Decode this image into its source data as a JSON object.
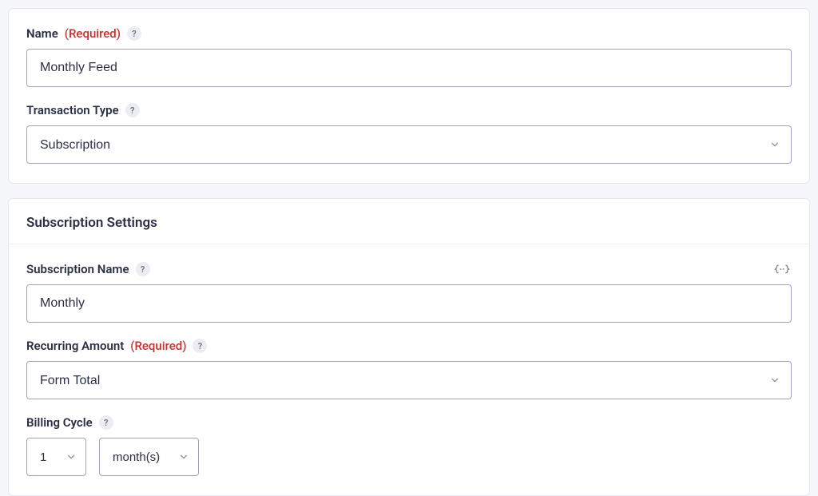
{
  "topPanel": {
    "name": {
      "label": "Name",
      "required": "(Required)",
      "helpGlyph": "?",
      "value": "Monthly Feed"
    },
    "transactionType": {
      "label": "Transaction Type",
      "helpGlyph": "?",
      "value": "Subscription"
    }
  },
  "settingsPanel": {
    "title": "Subscription Settings",
    "subscriptionName": {
      "label": "Subscription Name",
      "helpGlyph": "?",
      "value": "Monthly"
    },
    "recurringAmount": {
      "label": "Recurring Amount",
      "required": "(Required)",
      "helpGlyph": "?",
      "value": "Form Total"
    },
    "billingCycle": {
      "label": "Billing Cycle",
      "helpGlyph": "?",
      "intervalValue": "1",
      "unitValue": "month(s)"
    }
  }
}
